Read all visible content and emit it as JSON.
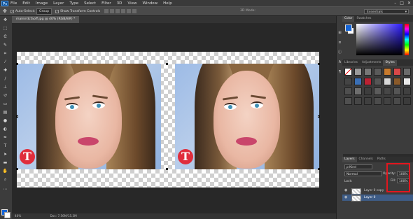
{
  "menu": {
    "logo": "Ps",
    "items": [
      "File",
      "Edit",
      "Image",
      "Layer",
      "Type",
      "Select",
      "Filter",
      "3D",
      "View",
      "Window",
      "Help"
    ],
    "window_controls": [
      "–",
      "□",
      "✕"
    ]
  },
  "options": {
    "auto_select_label": "Auto-Select:",
    "auto_select_value": "Group",
    "transform_label": "Show Transform Controls",
    "mode_3d": "3D Mode:",
    "workspace": "Essentials"
  },
  "document": {
    "tab_title": "mainrrdcfaoff.jpg @ 40% (RGB/8#) *",
    "status": "Doc: 7.56M/15.3M"
  },
  "panels": {
    "color_tabs": [
      "Color",
      "Swatches"
    ],
    "styles_tabs": [
      "Libraries",
      "Adjustments",
      "Styles"
    ],
    "layers_tabs": [
      "Layers",
      "Channels",
      "Paths"
    ],
    "kind_label": "ρ Kind",
    "blend_mode": "Normal",
    "opacity_label": "Opacity:",
    "opacity_value": "100%",
    "lock_label": "Lock:",
    "fill_label": "Fill:",
    "fill_value": "100%",
    "layers": [
      {
        "name": "Layer 0 copy",
        "selected": false
      },
      {
        "name": "Layer 0",
        "selected": true
      }
    ]
  },
  "badge": {
    "left": "T",
    "right": "T"
  },
  "colors": {
    "accent": "#e3161e",
    "foreground": "#1565d8",
    "badge": "#e02d3c"
  }
}
